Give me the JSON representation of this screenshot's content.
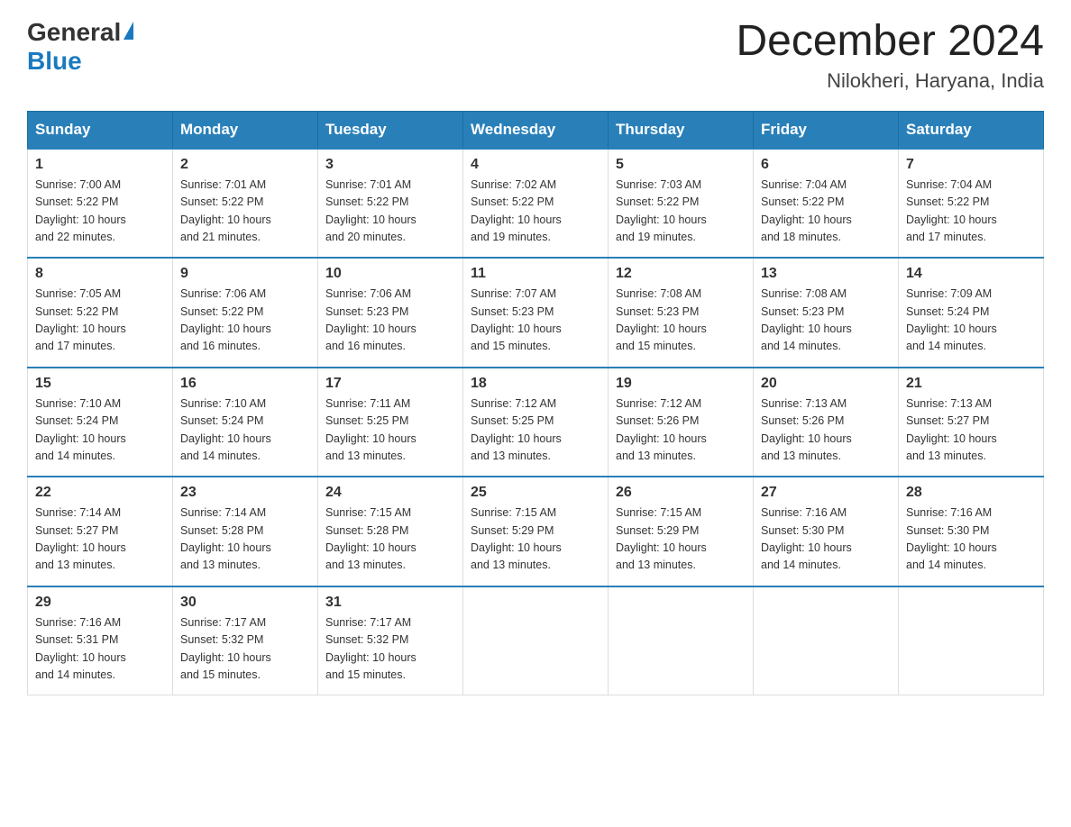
{
  "logo": {
    "general": "General",
    "blue": "Blue"
  },
  "title": {
    "month_year": "December 2024",
    "location": "Nilokheri, Haryana, India"
  },
  "headers": [
    "Sunday",
    "Monday",
    "Tuesday",
    "Wednesday",
    "Thursday",
    "Friday",
    "Saturday"
  ],
  "weeks": [
    [
      {
        "day": "1",
        "sunrise": "7:00 AM",
        "sunset": "5:22 PM",
        "daylight": "10 hours and 22 minutes."
      },
      {
        "day": "2",
        "sunrise": "7:01 AM",
        "sunset": "5:22 PM",
        "daylight": "10 hours and 21 minutes."
      },
      {
        "day": "3",
        "sunrise": "7:01 AM",
        "sunset": "5:22 PM",
        "daylight": "10 hours and 20 minutes."
      },
      {
        "day": "4",
        "sunrise": "7:02 AM",
        "sunset": "5:22 PM",
        "daylight": "10 hours and 19 minutes."
      },
      {
        "day": "5",
        "sunrise": "7:03 AM",
        "sunset": "5:22 PM",
        "daylight": "10 hours and 19 minutes."
      },
      {
        "day": "6",
        "sunrise": "7:04 AM",
        "sunset": "5:22 PM",
        "daylight": "10 hours and 18 minutes."
      },
      {
        "day": "7",
        "sunrise": "7:04 AM",
        "sunset": "5:22 PM",
        "daylight": "10 hours and 17 minutes."
      }
    ],
    [
      {
        "day": "8",
        "sunrise": "7:05 AM",
        "sunset": "5:22 PM",
        "daylight": "10 hours and 17 minutes."
      },
      {
        "day": "9",
        "sunrise": "7:06 AM",
        "sunset": "5:22 PM",
        "daylight": "10 hours and 16 minutes."
      },
      {
        "day": "10",
        "sunrise": "7:06 AM",
        "sunset": "5:23 PM",
        "daylight": "10 hours and 16 minutes."
      },
      {
        "day": "11",
        "sunrise": "7:07 AM",
        "sunset": "5:23 PM",
        "daylight": "10 hours and 15 minutes."
      },
      {
        "day": "12",
        "sunrise": "7:08 AM",
        "sunset": "5:23 PM",
        "daylight": "10 hours and 15 minutes."
      },
      {
        "day": "13",
        "sunrise": "7:08 AM",
        "sunset": "5:23 PM",
        "daylight": "10 hours and 14 minutes."
      },
      {
        "day": "14",
        "sunrise": "7:09 AM",
        "sunset": "5:24 PM",
        "daylight": "10 hours and 14 minutes."
      }
    ],
    [
      {
        "day": "15",
        "sunrise": "7:10 AM",
        "sunset": "5:24 PM",
        "daylight": "10 hours and 14 minutes."
      },
      {
        "day": "16",
        "sunrise": "7:10 AM",
        "sunset": "5:24 PM",
        "daylight": "10 hours and 14 minutes."
      },
      {
        "day": "17",
        "sunrise": "7:11 AM",
        "sunset": "5:25 PM",
        "daylight": "10 hours and 13 minutes."
      },
      {
        "day": "18",
        "sunrise": "7:12 AM",
        "sunset": "5:25 PM",
        "daylight": "10 hours and 13 minutes."
      },
      {
        "day": "19",
        "sunrise": "7:12 AM",
        "sunset": "5:26 PM",
        "daylight": "10 hours and 13 minutes."
      },
      {
        "day": "20",
        "sunrise": "7:13 AM",
        "sunset": "5:26 PM",
        "daylight": "10 hours and 13 minutes."
      },
      {
        "day": "21",
        "sunrise": "7:13 AM",
        "sunset": "5:27 PM",
        "daylight": "10 hours and 13 minutes."
      }
    ],
    [
      {
        "day": "22",
        "sunrise": "7:14 AM",
        "sunset": "5:27 PM",
        "daylight": "10 hours and 13 minutes."
      },
      {
        "day": "23",
        "sunrise": "7:14 AM",
        "sunset": "5:28 PM",
        "daylight": "10 hours and 13 minutes."
      },
      {
        "day": "24",
        "sunrise": "7:15 AM",
        "sunset": "5:28 PM",
        "daylight": "10 hours and 13 minutes."
      },
      {
        "day": "25",
        "sunrise": "7:15 AM",
        "sunset": "5:29 PM",
        "daylight": "10 hours and 13 minutes."
      },
      {
        "day": "26",
        "sunrise": "7:15 AM",
        "sunset": "5:29 PM",
        "daylight": "10 hours and 13 minutes."
      },
      {
        "day": "27",
        "sunrise": "7:16 AM",
        "sunset": "5:30 PM",
        "daylight": "10 hours and 14 minutes."
      },
      {
        "day": "28",
        "sunrise": "7:16 AM",
        "sunset": "5:30 PM",
        "daylight": "10 hours and 14 minutes."
      }
    ],
    [
      {
        "day": "29",
        "sunrise": "7:16 AM",
        "sunset": "5:31 PM",
        "daylight": "10 hours and 14 minutes."
      },
      {
        "day": "30",
        "sunrise": "7:17 AM",
        "sunset": "5:32 PM",
        "daylight": "10 hours and 15 minutes."
      },
      {
        "day": "31",
        "sunrise": "7:17 AM",
        "sunset": "5:32 PM",
        "daylight": "10 hours and 15 minutes."
      },
      null,
      null,
      null,
      null
    ]
  ],
  "labels": {
    "sunrise": "Sunrise: ",
    "sunset": "Sunset: ",
    "daylight": "Daylight: "
  }
}
